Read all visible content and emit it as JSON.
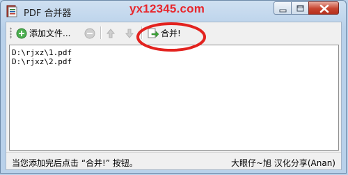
{
  "window": {
    "title": "PDF 合并器",
    "watermark": "yx12345.com"
  },
  "toolbar": {
    "add_files_label": "添加文件...",
    "merge_label": "合并!"
  },
  "files": [
    "D:\\rjxz\\1.pdf",
    "D:\\rjxz\\2.pdf"
  ],
  "status": {
    "hint": "当您添加完后点击 “合并!” 按钮。",
    "credit": "大眼仔~旭 汉化分享(Anan)"
  },
  "colors": {
    "annotation_circle": "#e3231f",
    "close_button": "#c7452f"
  },
  "icons": {
    "add": "add-icon",
    "remove": "remove-icon",
    "move_up": "arrow-up-icon",
    "move_down": "arrow-down-icon",
    "merge": "merge-icon"
  }
}
